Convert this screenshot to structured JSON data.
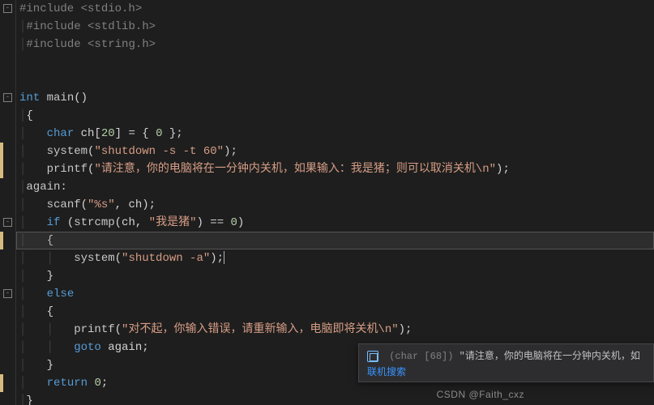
{
  "code": {
    "l1_a": "#include ",
    "l1_b": "<stdio.h>",
    "l2_a": "#include ",
    "l2_b": "<stdlib.h>",
    "l3_a": "#include ",
    "l3_b": "<string.h>",
    "l5_int": "int",
    "l5_main": " main",
    "l5_p": "()",
    "l6": "{",
    "l7_char": "char",
    "l7_decl": " ch[",
    "l7_20": "20",
    "l7_mid": "] = { ",
    "l7_0": "0",
    "l7_end": " };",
    "l8_fn": "system",
    "l8_p1": "(",
    "l8_str": "\"shutdown -s -t 60\"",
    "l8_p2": ");",
    "l9_fn": "printf",
    "l9_p1": "(",
    "l9_str": "\"请注意，你的电脑将在一分钟内关机，如果输入：我是猪；则可以取消关机\\n\"",
    "l9_p2": ");",
    "l10_lbl": "again:",
    "l11_fn": "scanf",
    "l11_p1": "(",
    "l11_str": "\"%s\"",
    "l11_c": ", ch",
    "l11_p2": ");",
    "l12_if": "if",
    "l12_p1": " (",
    "l12_fn": "strcmp",
    "l12_p2": "(ch, ",
    "l12_str": "\"我是猪\"",
    "l12_p3": ") == ",
    "l12_0": "0",
    "l12_p4": ")",
    "l13": "{",
    "l14_fn": "system",
    "l14_p1": "(",
    "l14_str": "\"shutdown -a\"",
    "l14_p2": ");",
    "l15": "}",
    "l16_else": "else",
    "l17": "{",
    "l18_fn": "printf",
    "l18_p1": "(",
    "l18_str": "\"对不起，你输入错误，请重新输入，电脑即将关机\\n\"",
    "l18_p2": ");",
    "l19_goto": "goto",
    "l19_tgt": " again;",
    "l20": "}",
    "l21_ret": "return",
    "l21_val": " ",
    "l21_0": "0",
    "l21_sc": ";",
    "l22": "}"
  },
  "tooltip": {
    "type": "(char [68])",
    "text": "\"请注意，你的电脑将在一分钟内关机，如",
    "link": "联机搜索"
  },
  "watermark": "CSDN @Faith_cxz",
  "fold_glyph": "-"
}
